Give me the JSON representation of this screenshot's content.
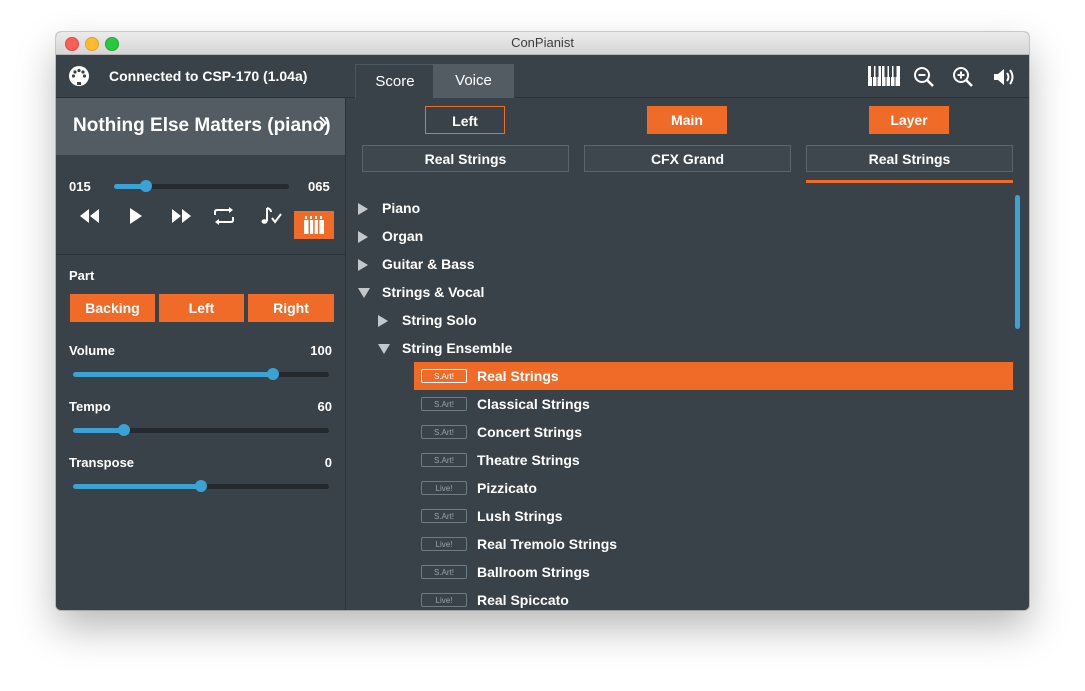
{
  "window": {
    "title": "ConPianist"
  },
  "topbar": {
    "connection_icon": "midi-connector-icon",
    "connection_text": "Connected to CSP-170 (1.04a)",
    "tabs": [
      {
        "label": "Score",
        "active": false
      },
      {
        "label": "Voice",
        "active": true
      }
    ],
    "icons": [
      "piano-keyboard-icon",
      "zoom-out-icon",
      "zoom-in-icon",
      "volume-icon"
    ]
  },
  "song": {
    "title": "Nothing Else Matters (piano)"
  },
  "position": {
    "start": "015",
    "end": "065",
    "level": 0.18
  },
  "transport": [
    "rewind-icon",
    "play-icon",
    "fast-forward-icon",
    "repeat-icon",
    "note-check-icon",
    "guide-lamps-icon"
  ],
  "part": {
    "label": "Part",
    "buttons": [
      "Backing",
      "Left",
      "Right"
    ]
  },
  "controls": [
    {
      "label": "Volume",
      "value": "100",
      "level": 0.78
    },
    {
      "label": "Tempo",
      "value": "60",
      "level": 0.2
    },
    {
      "label": "Transpose",
      "value": "0",
      "level": 0.5
    }
  ],
  "selectors": [
    {
      "label": "Left",
      "style": "outline"
    },
    {
      "label": "Main",
      "style": "filled"
    },
    {
      "label": "Layer",
      "style": "filled"
    }
  ],
  "voices_assigned": [
    "Real Strings",
    "CFX Grand",
    "Real Strings"
  ],
  "tree": {
    "categories": [
      "Piano",
      "Organ",
      "Guitar & Bass",
      "Strings & Vocal"
    ],
    "subcategories": [
      "String Solo",
      "String Ensemble"
    ],
    "voices": [
      {
        "badge": "S.Art!",
        "name": "Real Strings",
        "selected": true
      },
      {
        "badge": "S.Art!",
        "name": "Classical Strings",
        "selected": false
      },
      {
        "badge": "S.Art!",
        "name": "Concert Strings",
        "selected": false
      },
      {
        "badge": "S.Art!",
        "name": "Theatre Strings",
        "selected": false
      },
      {
        "badge": "Live!",
        "name": "Pizzicato",
        "selected": false
      },
      {
        "badge": "S.Art!",
        "name": "Lush Strings",
        "selected": false
      },
      {
        "badge": "Live!",
        "name": "Real Tremolo Strings",
        "selected": false
      },
      {
        "badge": "S.Art!",
        "name": "Ballroom Strings",
        "selected": false
      },
      {
        "badge": "Live!",
        "name": "Real Spiccato",
        "selected": false
      }
    ]
  },
  "colors": {
    "accent": "#f06b28",
    "slider": "#3aa3d4",
    "panel": "#394248",
    "header": "#535c62"
  }
}
